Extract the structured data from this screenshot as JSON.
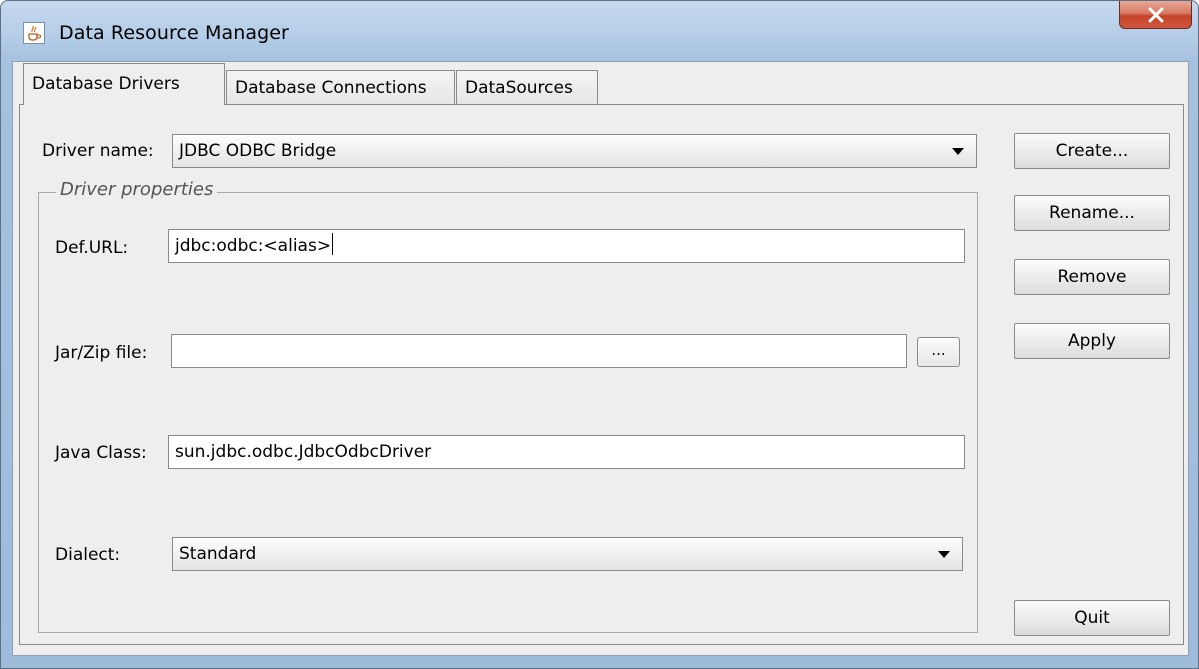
{
  "window": {
    "title": "Data Resource Manager"
  },
  "tabs": [
    {
      "label": "Database Drivers",
      "selected": true
    },
    {
      "label": "Database Connections",
      "selected": false
    },
    {
      "label": "DataSources",
      "selected": false
    }
  ],
  "driver": {
    "name_label": "Driver name:",
    "name_value": "JDBC ODBC Bridge"
  },
  "properties": {
    "group_title": "Driver properties",
    "def_url_label": "Def.URL:",
    "def_url_value": "jdbc:odbc:<alias>",
    "jar_label": "Jar/Zip file:",
    "jar_value": "",
    "browse_label": "...",
    "java_class_label": "Java Class:",
    "java_class_value": "sun.jdbc.odbc.JdbcOdbcDriver",
    "dialect_label": "Dialect:",
    "dialect_value": "Standard"
  },
  "buttons": {
    "create": "Create...",
    "rename": "Rename...",
    "remove": "Remove",
    "apply": "Apply",
    "quit": "Quit"
  },
  "icons": {
    "app": "java-cup-icon",
    "close": "close-x-icon"
  }
}
